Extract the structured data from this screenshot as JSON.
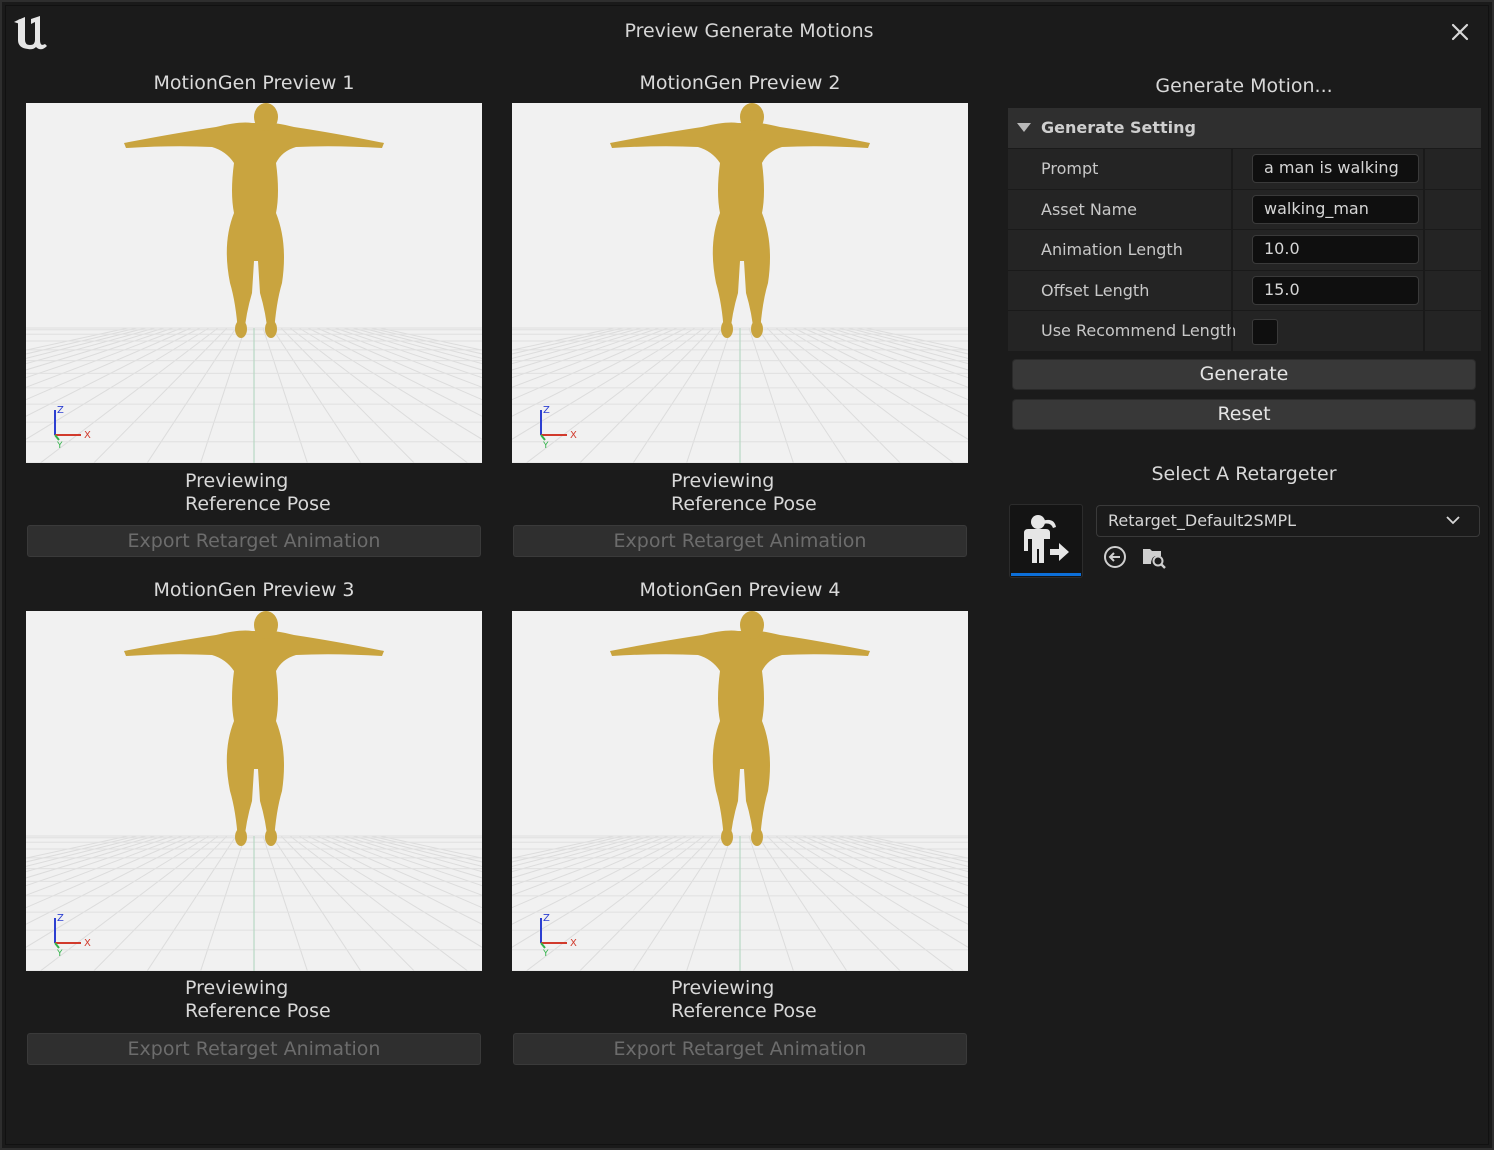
{
  "window": {
    "title": "Preview Generate Motions"
  },
  "previews": [
    {
      "title": "MotionGen Preview 1",
      "status_line1": "Previewing",
      "status_line2": "Reference Pose",
      "export_label": "Export Retarget Animation",
      "axis_z": "Z",
      "axis_x": "X",
      "axis_y": "Y"
    },
    {
      "title": "MotionGen Preview 2",
      "status_line1": "Previewing",
      "status_line2": "Reference Pose",
      "export_label": "Export Retarget Animation",
      "axis_z": "Z",
      "axis_x": "X",
      "axis_y": "Y"
    },
    {
      "title": "MotionGen Preview 3",
      "status_line1": "Previewing",
      "status_line2": "Reference Pose",
      "export_label": "Export Retarget Animation",
      "axis_z": "Z",
      "axis_x": "X",
      "axis_y": "Y"
    },
    {
      "title": "MotionGen Preview 4",
      "status_line1": "Previewing",
      "status_line2": "Reference Pose",
      "export_label": "Export Retarget Animation",
      "axis_z": "Z",
      "axis_x": "X",
      "axis_y": "Y"
    }
  ],
  "panel": {
    "heading": "Generate Motion...",
    "settings_header": "Generate Setting",
    "rows": [
      {
        "label": "Prompt",
        "value": "a man is walking"
      },
      {
        "label": "Asset Name",
        "value": "walking_man"
      },
      {
        "label": "Animation Length",
        "value": "10.0"
      },
      {
        "label": "Offset Length",
        "value": "15.0"
      },
      {
        "label": "Use Recommend Length",
        "checked": false
      }
    ],
    "generate_label": "Generate",
    "reset_label": "Reset",
    "retarget_heading": "Select A Retargeter",
    "retarget_value": "Retarget_Default2SMPL"
  },
  "colors": {
    "body": "#c9a43f",
    "accent": "#0d6fd8",
    "viewport_bg": "#f1f1f1"
  },
  "icons": [
    "unreal-logo-icon",
    "close-icon",
    "retarget-asset-icon",
    "chevron-down-icon",
    "use-selected-icon",
    "browse-icon"
  ]
}
